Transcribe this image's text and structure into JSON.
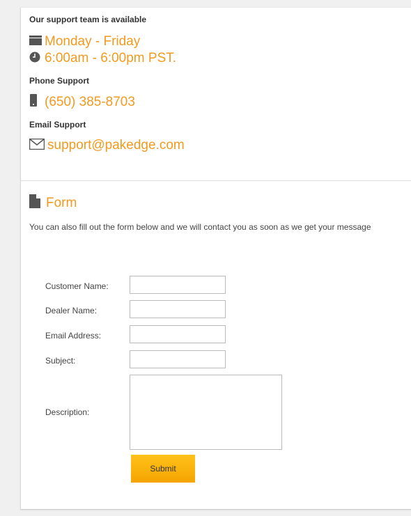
{
  "support": {
    "heading": "Our support team is available",
    "days": "Monday - Friday",
    "hours": "6:00am - 6:00pm PST.",
    "phone_heading": "Phone Support",
    "phone": "(650) 385-8703",
    "email_heading": "Email Support",
    "email": "support@pakedge.com"
  },
  "form": {
    "title": "Form",
    "intro": "You can also fill out the form below and we will contact you as soon as we get your message",
    "fields": {
      "customer_name": {
        "label": "Customer Name:",
        "value": ""
      },
      "dealer_name": {
        "label": "Dealer Name:",
        "value": ""
      },
      "email_address": {
        "label": "Email Address:",
        "value": ""
      },
      "subject": {
        "label": "Subject:",
        "value": ""
      },
      "description": {
        "label": "Description:",
        "value": ""
      }
    },
    "submit_label": "Submit"
  },
  "colors": {
    "accent": "#f29a1f",
    "button": "#f5a400",
    "icon": "#555555"
  },
  "icons": {
    "calendar": "calendar-icon",
    "clock": "clock-icon",
    "phone": "phone-icon",
    "email": "envelope-icon",
    "form": "document-icon"
  }
}
